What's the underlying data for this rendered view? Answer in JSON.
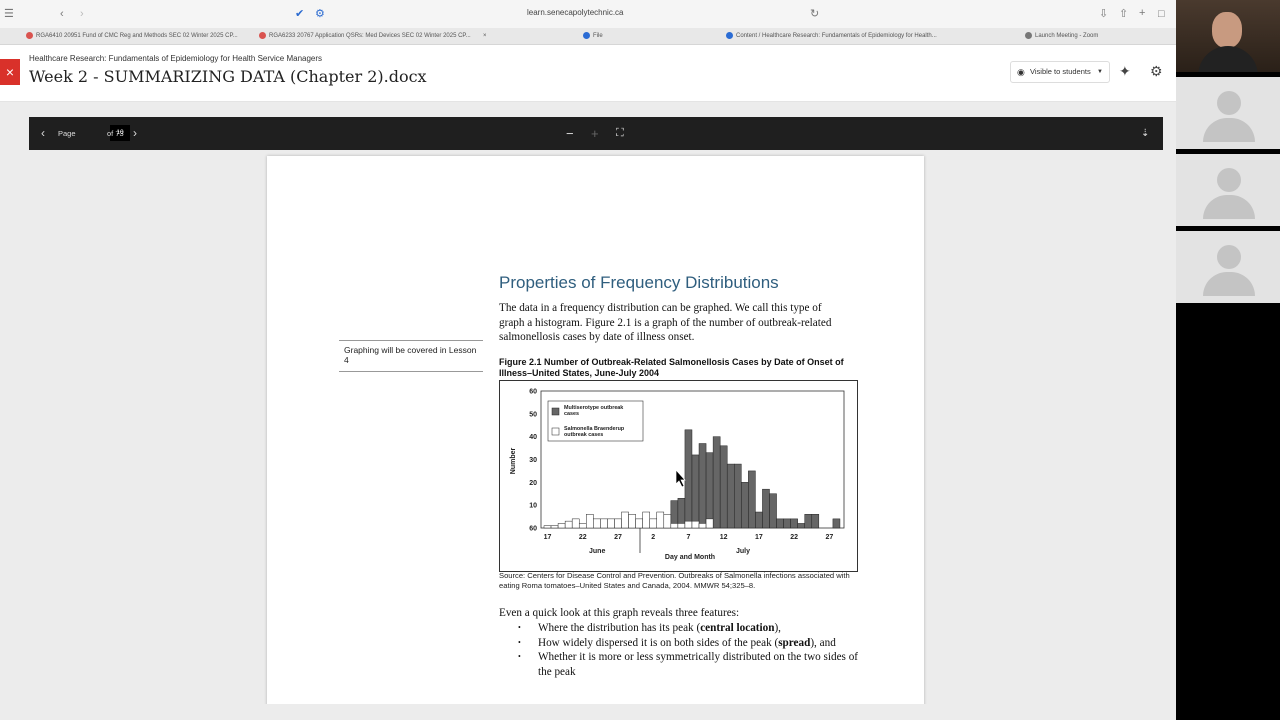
{
  "browser": {
    "url": "learn.senecapolytechnic.ca",
    "tabs": [
      {
        "label": "RGA6410 20951 Fund of CMC Reg and Methods SEC 02 Winter 2025 CP...",
        "color": "#d9534f"
      },
      {
        "label": "RGA6233 20767 Application QSRs: Med Devices SEC 02 Winter 2025 CP...",
        "color": "#d9534f"
      },
      {
        "label": "File",
        "color": "#2b6cd4"
      },
      {
        "label": "Content / Healthcare Research: Fundamentals of Epidemiology for Health...",
        "color": "#2b6cd4"
      },
      {
        "label": "Launch Meeting - Zoom",
        "color": "#777777"
      }
    ]
  },
  "header": {
    "breadcrumb": "Healthcare Research: Fundamentals of Epidemiology for Health Service Managers",
    "title": "Week 2 - SUMMARIZING DATA (Chapter 2).docx",
    "visibility": "Visible to students"
  },
  "viewer": {
    "page_label": "Page",
    "page_number": "10",
    "page_total": "of 73"
  },
  "document": {
    "section_title": "Properties of Frequency Distributions",
    "intro": "The data in a frequency distribution can be graphed. We call this type of graph a histogram. Figure 2.1 is a graph of the number of outbreak-related salmonellosis cases by date of illness onset.",
    "sidenote": "Graphing will be covered in Lesson 4",
    "figure_caption": "Figure 2.1 Number of Outbreak-Related Salmonellosis Cases by Date of Onset of Illness–United States, June-July 2004",
    "source": "Source: Centers for Disease Control and Prevention. Outbreaks of Salmonella infections associated with eating Roma tomatoes–United States and Canada, 2004. MMWR 54;325–8.",
    "features_intro": "Even a quick look at this graph reveals three features:",
    "features": [
      {
        "pre": "Where the distribution has its peak (",
        "bold": "central location",
        "post": "),"
      },
      {
        "pre": "How widely dispersed it is on both sides of the peak (",
        "bold": "spread",
        "post": "), and"
      },
      {
        "pre": "Whether it is more or less symmetrically distributed on the two sides of the peak",
        "bold": "",
        "post": ""
      }
    ]
  },
  "chart_data": {
    "type": "bar",
    "ylabel": "Number",
    "xlabel": "Day and Month",
    "ylim": [
      0,
      60
    ],
    "yticks": [
      "60",
      "50",
      "40",
      "30",
      "20",
      "10",
      "60"
    ],
    "xticks": [
      "17",
      "22",
      "27",
      "2",
      "7",
      "12",
      "17",
      "22",
      "27"
    ],
    "month_labels": [
      "June",
      "July"
    ],
    "legend": {
      "placement": "top-left"
    },
    "series": [
      {
        "name": "Multiserotype outbreak cases",
        "color": "#666666",
        "values": [
          0,
          0,
          0,
          0,
          0,
          0,
          0,
          0,
          0,
          0,
          0,
          0,
          0,
          0,
          0,
          2,
          0,
          3,
          12,
          13,
          43,
          32,
          37,
          33,
          40,
          36,
          28,
          28,
          20,
          25,
          7,
          17,
          15,
          4,
          4,
          4,
          2,
          6,
          6,
          0,
          0,
          4
        ]
      },
      {
        "name": "Salmonella Braenderup outbreak cases",
        "color": "#ffffff",
        "values": [
          1,
          1,
          2,
          3,
          4,
          2,
          6,
          4,
          4,
          4,
          4,
          7,
          6,
          4,
          7,
          4,
          7,
          6,
          2,
          2,
          3,
          3,
          2,
          4,
          0,
          0,
          0,
          0,
          0,
          0,
          0,
          0,
          0,
          0,
          0,
          0,
          0,
          0,
          0,
          0,
          0,
          0
        ]
      }
    ]
  },
  "participants": {
    "count": 3
  }
}
